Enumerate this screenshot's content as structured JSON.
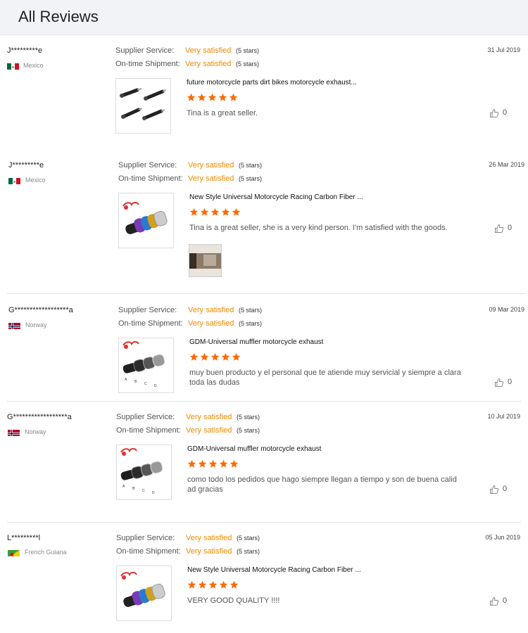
{
  "page": {
    "title": "All Reviews"
  },
  "labels": {
    "supplier_service": "Supplier Service:",
    "ontime_shipment": "On-time Shipment:"
  },
  "colors": {
    "accent": "#f08a00",
    "star": "#ff6a00",
    "header_bg": "#f2f3f7"
  },
  "reviews": [
    {
      "buyer": "J*********e",
      "country": "Mexico",
      "flag": "mexico-flag",
      "date": "31 Jul 2019",
      "supplier_service": {
        "value": "Very satisfied",
        "stars": "(5 stars)"
      },
      "ontime_shipment": {
        "value": "Very satisfied",
        "stars": "(5 stars)"
      },
      "product_title": "future motorcycle parts dirt bikes motorcycle exhaust...",
      "rating": 5,
      "text": "Tina is a great seller.",
      "likes": "0"
    },
    {
      "buyer": "J*********e",
      "country": "Mexico",
      "flag": "mexico-flag",
      "date": "26 Mar 2019",
      "supplier_service": {
        "value": "Very satisfied",
        "stars": "(5 stars)"
      },
      "ontime_shipment": {
        "value": "Very satisfied",
        "stars": "(5 stars)"
      },
      "product_title": "New Style Universal Motorcycle Racing Carbon Fiber ...",
      "rating": 5,
      "text": "Tina is a great seller, she is a very kind person. I'm satisfied with the goods.",
      "likes": "0"
    },
    {
      "buyer": "G******************a",
      "country": "Norway",
      "flag": "norway-flag",
      "date": "09 Mar 2019",
      "supplier_service": {
        "value": "Very satisfied",
        "stars": "(5 stars)"
      },
      "ontime_shipment": {
        "value": "Very satisfied",
        "stars": "(5 stars)"
      },
      "product_title": "GDM-Universal muffler motorcycle exhaust",
      "rating": 5,
      "text": "muy buen producto y el personal que te atiende muy servicial y siempre a clara toda las dudas",
      "likes": "0"
    },
    {
      "buyer": "G******************a",
      "country": "Norway",
      "flag": "norway-flag",
      "date": "10 Jul 2019",
      "supplier_service": {
        "value": "Very satisfied",
        "stars": "(5 stars)"
      },
      "ontime_shipment": {
        "value": "Very satisfied",
        "stars": "(5 stars)"
      },
      "product_title": "GDM-Universal muffler motorcycle exhaust",
      "rating": 5,
      "text": "como todo los pedidos que hago siempre llegan a tiempo y son de buena calid ad gracias",
      "likes": "0"
    },
    {
      "buyer": "L*********l",
      "country": "French Guiana",
      "flag": "french-guiana-flag",
      "date": "05 Jun 2019",
      "supplier_service": {
        "value": "Very satisfied",
        "stars": "(5 stars)"
      },
      "ontime_shipment": {
        "value": "Very satisfied",
        "stars": "(5 stars)"
      },
      "product_title": "New Style Universal Motorcycle Racing Carbon Fiber ...",
      "rating": 5,
      "text": "VERY GOOD QUALITY !!!!",
      "likes": "0"
    }
  ]
}
